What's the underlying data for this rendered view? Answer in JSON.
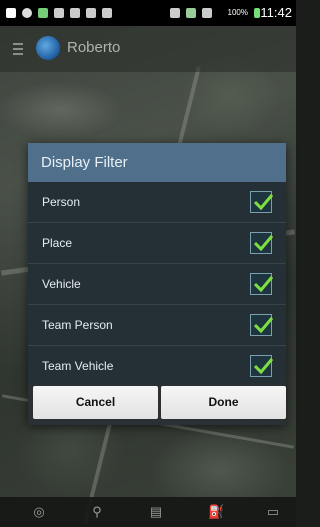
{
  "status_bar": {
    "battery": "100%",
    "time": "11:42"
  },
  "action_bar": {
    "title": "Roberto",
    "menu_icon": "hamburger-icon",
    "logo_icon": "globe-icon"
  },
  "dialog": {
    "title": "Display Filter",
    "items": [
      {
        "label": "Person",
        "checked": true
      },
      {
        "label": "Place",
        "checked": true
      },
      {
        "label": "Vehicle",
        "checked": true
      },
      {
        "label": "Team Person",
        "checked": true
      },
      {
        "label": "Team Vehicle",
        "checked": true
      }
    ],
    "cancel_label": "Cancel",
    "done_label": "Done"
  },
  "bottom_bar": {
    "icons": [
      "locate-icon",
      "search-icon",
      "list-icon",
      "fuel-icon",
      "chat-icon"
    ]
  },
  "colors": {
    "dialog_header": "#4f6f8b",
    "check_mark": "#7de040"
  }
}
